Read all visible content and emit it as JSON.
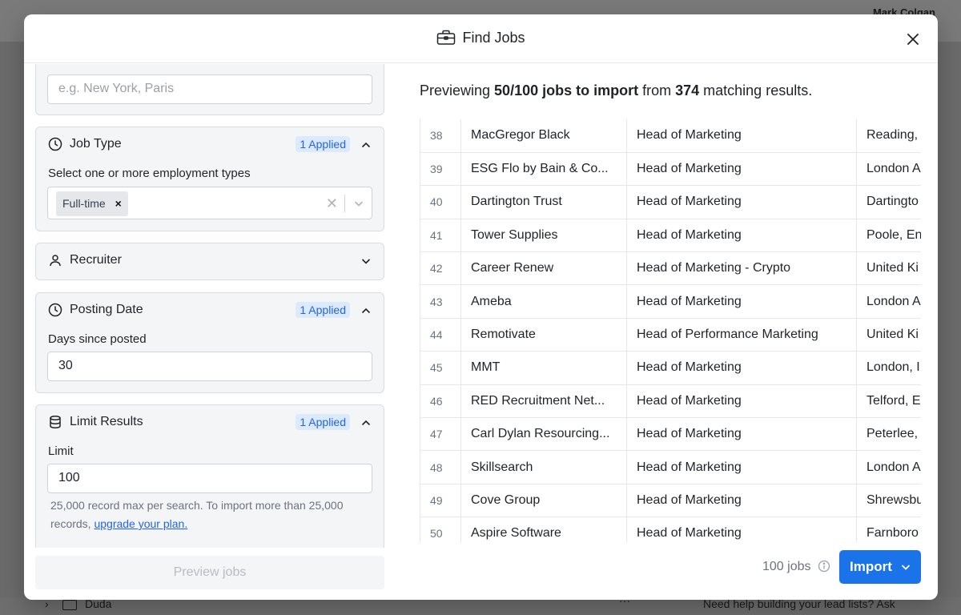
{
  "backdrop": {
    "user_name": "Mark Colgan",
    "folder_name": "Duda",
    "help_text": "Need help building your lead lists? Ask"
  },
  "modal": {
    "title": "Find Jobs",
    "icon": "briefcase-icon"
  },
  "filters": {
    "location": {
      "placeholder": "e.g. New York, Paris"
    },
    "job_type": {
      "label": "Job Type",
      "badge": "1 Applied",
      "sub_label": "Select one or more employment types",
      "selected": [
        "Full-time"
      ]
    },
    "recruiter": {
      "label": "Recruiter"
    },
    "posting_date": {
      "label": "Posting Date",
      "badge": "1 Applied",
      "sub_label": "Days since posted",
      "value": "30"
    },
    "limit_results": {
      "label": "Limit Results",
      "badge": "1 Applied",
      "sub_label": "Limit",
      "value": "100",
      "help_text": "25,000 record max per search. To import more than 25,000 records, ",
      "help_link": "upgrade your plan."
    },
    "preview_button": "Preview jobs"
  },
  "preview": {
    "prefix": "Previewing ",
    "count_bold": "50/100 jobs to import",
    "middle": " from ",
    "matches_bold": "374",
    "suffix": " matching results."
  },
  "jobs": [
    {
      "num": "38",
      "company": "MacGregor Black",
      "title": "Head of Marketing",
      "location": "Reading, "
    },
    {
      "num": "39",
      "company": "ESG Flo by Bain & Co...",
      "title": "Head of Marketing",
      "location": "London A"
    },
    {
      "num": "40",
      "company": "Dartington Trust",
      "title": "Head of Marketing",
      "location": "Dartingto"
    },
    {
      "num": "41",
      "company": "Tower Supplies",
      "title": "Head of Marketing",
      "location": "Poole, En"
    },
    {
      "num": "42",
      "company": "Career Renew",
      "title": "Head of Marketing - Crypto",
      "location": "United Ki"
    },
    {
      "num": "43",
      "company": "Ameba",
      "title": "Head of Marketing",
      "location": "London A"
    },
    {
      "num": "44",
      "company": "Remotivate",
      "title": "Head of Performance Marketing",
      "location": "United Ki"
    },
    {
      "num": "45",
      "company": "MMT",
      "title": "Head of Marketing",
      "location": "London, I"
    },
    {
      "num": "46",
      "company": "RED Recruitment Net...",
      "title": "Head of Marketing",
      "location": "Telford, E"
    },
    {
      "num": "47",
      "company": "Carl Dylan Resourcing...",
      "title": "Head of Marketing",
      "location": "Peterlee,"
    },
    {
      "num": "48",
      "company": "Skillsearch",
      "title": "Head of Marketing",
      "location": "London A"
    },
    {
      "num": "49",
      "company": "Cove Group",
      "title": "Head of Marketing",
      "location": "Shrewsbu"
    },
    {
      "num": "50",
      "company": "Aspire Software",
      "title": "Head of Marketing",
      "location": "Farnboro"
    }
  ],
  "footer": {
    "jobs_count": "100 jobs",
    "import_label": "Import"
  },
  "colors": {
    "accent": "#1a73e8",
    "badge_bg": "#dbeafe",
    "badge_text": "#2563eb"
  }
}
